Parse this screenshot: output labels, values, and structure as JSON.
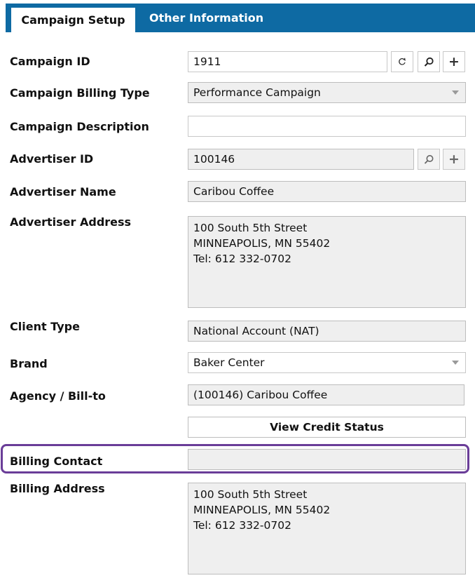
{
  "tabs": {
    "campaign_setup": "Campaign Setup",
    "other_information": "Other Information"
  },
  "form": {
    "campaign_id": {
      "label": "Campaign ID",
      "value": "1911"
    },
    "billing_type": {
      "label": "Campaign Billing Type",
      "value": "Performance Campaign"
    },
    "campaign_description": {
      "label": "Campaign Description",
      "value": ""
    },
    "advertiser_id": {
      "label": "Advertiser ID",
      "value": "100146"
    },
    "advertiser_name": {
      "label": "Advertiser Name",
      "value": "Caribou Coffee"
    },
    "advertiser_address": {
      "label": "Advertiser Address",
      "value": "100 South 5th Street\nMINNEAPOLIS, MN 55402\nTel: 612 332-0702"
    },
    "client_type": {
      "label": "Client Type",
      "value": "National Account (NAT)"
    },
    "brand": {
      "label": "Brand",
      "value": "Baker Center"
    },
    "agency_bill_to": {
      "label": "Agency / Bill-to",
      "value": "(100146) Caribou Coffee"
    },
    "view_credit_status": "View Credit Status",
    "billing_contact": {
      "label": "Billing Contact",
      "value": ""
    },
    "billing_address": {
      "label": "Billing Address",
      "value": "100 South 5th Street\nMINNEAPOLIS, MN 55402\nTel: 612 332-0702"
    }
  },
  "icons": {
    "refresh": "refresh-icon",
    "search": "search-icon",
    "add": "plus-icon"
  },
  "colors": {
    "tab_bar": "#0e6aa3",
    "highlight": "#6a3d98",
    "readonly_field": "#efefef"
  }
}
